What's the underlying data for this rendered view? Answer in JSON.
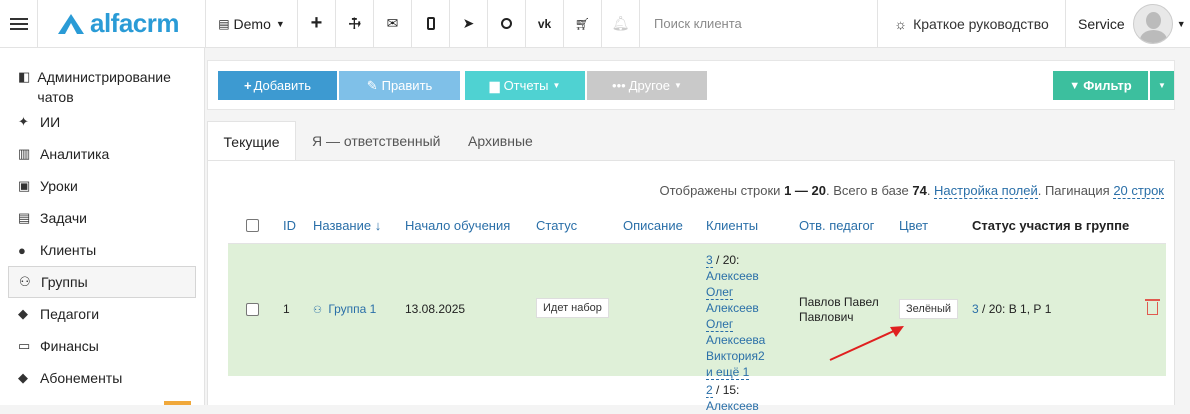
{
  "topbar": {
    "logo": "alfacrm",
    "branch": "Demo",
    "icons": [
      "plus-icon",
      "wrench-icon",
      "mail-icon",
      "phone-icon",
      "telegram-icon",
      "whatsapp-icon",
      "vk-icon",
      "cart-icon",
      "bell-icon"
    ],
    "search_placeholder": "Поиск клиента",
    "guide": "Краткое руководство",
    "user": "Service"
  },
  "sidebar": {
    "items": [
      {
        "label": "Администрирование чатов",
        "icon": "chat-admin-icon"
      },
      {
        "label": "ИИ",
        "icon": "sparkle-icon"
      },
      {
        "label": "Аналитика",
        "icon": "map-icon"
      },
      {
        "label": "Уроки",
        "icon": "calendar-icon"
      },
      {
        "label": "Задачи",
        "icon": "clipboard-icon"
      },
      {
        "label": "Клиенты",
        "icon": "user-icon"
      },
      {
        "label": "Группы",
        "icon": "users-icon"
      },
      {
        "label": "Педагоги",
        "icon": "graduation-cap-icon"
      },
      {
        "label": "Финансы",
        "icon": "money-icon"
      },
      {
        "label": "Абонементы",
        "icon": "tag-icon"
      }
    ],
    "active": "Группы"
  },
  "toolbar": {
    "add": "Добавить",
    "edit": "Править",
    "reports": "Отчеты",
    "other": "Другое",
    "filter": "Фильтр"
  },
  "tabs": [
    "Текущие",
    "Я — ответственный",
    "Архивные"
  ],
  "info": {
    "prefix": "Отображены строки",
    "range": "1 — 20",
    "total_text": ". Всего в базе",
    "total": "74",
    "settings": "Настройка полей",
    "pagination_label": ". Пагинация",
    "pagination": "20 строк"
  },
  "table": {
    "headers": [
      "ID",
      "Название ↓",
      "Начало обучения",
      "Статус",
      "Описание",
      "Клиенты",
      "Отв. педагог",
      "Цвет",
      "Статус участия в группе"
    ],
    "rows": [
      {
        "id": "1",
        "name": "Группа 1",
        "start": "13.08.2025",
        "status": "Идет набор",
        "clients_count": "3",
        "clients_cap": " / 20:",
        "clients": [
          "Алексеев",
          "Олег",
          "Алексеев",
          "Олег",
          "Алексеева",
          "Виктория2",
          "и ещё 1"
        ],
        "teacher": "Павлов Павел Павлович",
        "color": "Зелёный",
        "participation_count": "3",
        "participation_rest": " / 20:  В 1, Р 1"
      },
      {
        "clients_count": "2",
        "clients_cap": " / 15:",
        "clients": [
          "Алексеев"
        ]
      }
    ]
  },
  "accent_colors": {
    "add": "#3d9ad1",
    "filter": "#3cbf9e",
    "row_highlight": "#dff0d8",
    "arrow": "#e02020"
  }
}
